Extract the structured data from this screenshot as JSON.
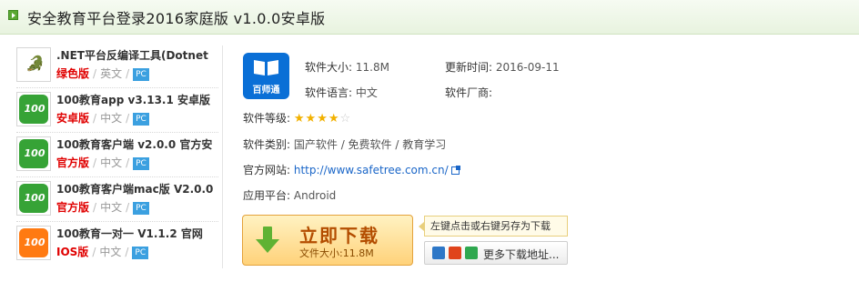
{
  "header": {
    "title": "安全教育平台登录2016家庭版 v1.0.0安卓版"
  },
  "related": [
    {
      "name": ".NET平台反编译工具(Dotnet",
      "tag": "绿色版",
      "lang": "英文",
      "platform": "PC",
      "thumb": "gray",
      "glyph": "🐊"
    },
    {
      "name": "100教育app v3.13.1 安卓版",
      "tag": "安卓版",
      "lang": "中文",
      "platform": "PC",
      "thumb": "green",
      "glyph": "100"
    },
    {
      "name": "100教育客户端 v2.0.0 官方安",
      "tag": "官方版",
      "lang": "中文",
      "platform": "PC",
      "thumb": "green",
      "glyph": "100"
    },
    {
      "name": "100教育客户端mac版 V2.0.0",
      "tag": "官方版",
      "lang": "中文",
      "platform": "PC",
      "thumb": "green",
      "glyph": "100"
    },
    {
      "name": "100教育一对一 V1.1.2 官网",
      "tag": "IOS版",
      "lang": "中文",
      "platform": "PC",
      "thumb": "orange",
      "glyph": "100"
    }
  ],
  "app": {
    "icon_text": "百师通",
    "size_label": "软件大小:",
    "size_value": "11.8M",
    "updated_label": "更新时间:",
    "updated_value": "2016-09-11",
    "language_label": "软件语言:",
    "language_value": "中文",
    "vendor_label": "软件厂商:",
    "vendor_value": "",
    "rating_label": "软件等级:",
    "rating_value": 4,
    "rating_max": 5,
    "category_label": "软件类别:",
    "category_value": "国产软件 / 免费软件 / 教育学习",
    "website_label": "官方网站:",
    "website_value": "http://www.safetree.com.cn/",
    "platform_label": "应用平台:",
    "platform_value": "Android"
  },
  "download": {
    "main_label": "立即下载",
    "size_label": "文件大小:11.8M",
    "tip": "左键点击或右键另存为下载",
    "more_label": "更多下载地址..."
  },
  "colors": {
    "accent_green": "#5aa832",
    "tag_red": "#e00000",
    "pc_badge": "#3ba0e0",
    "link_blue": "#1a66c8",
    "star": "#f2b100",
    "download_text": "#b34d00"
  }
}
